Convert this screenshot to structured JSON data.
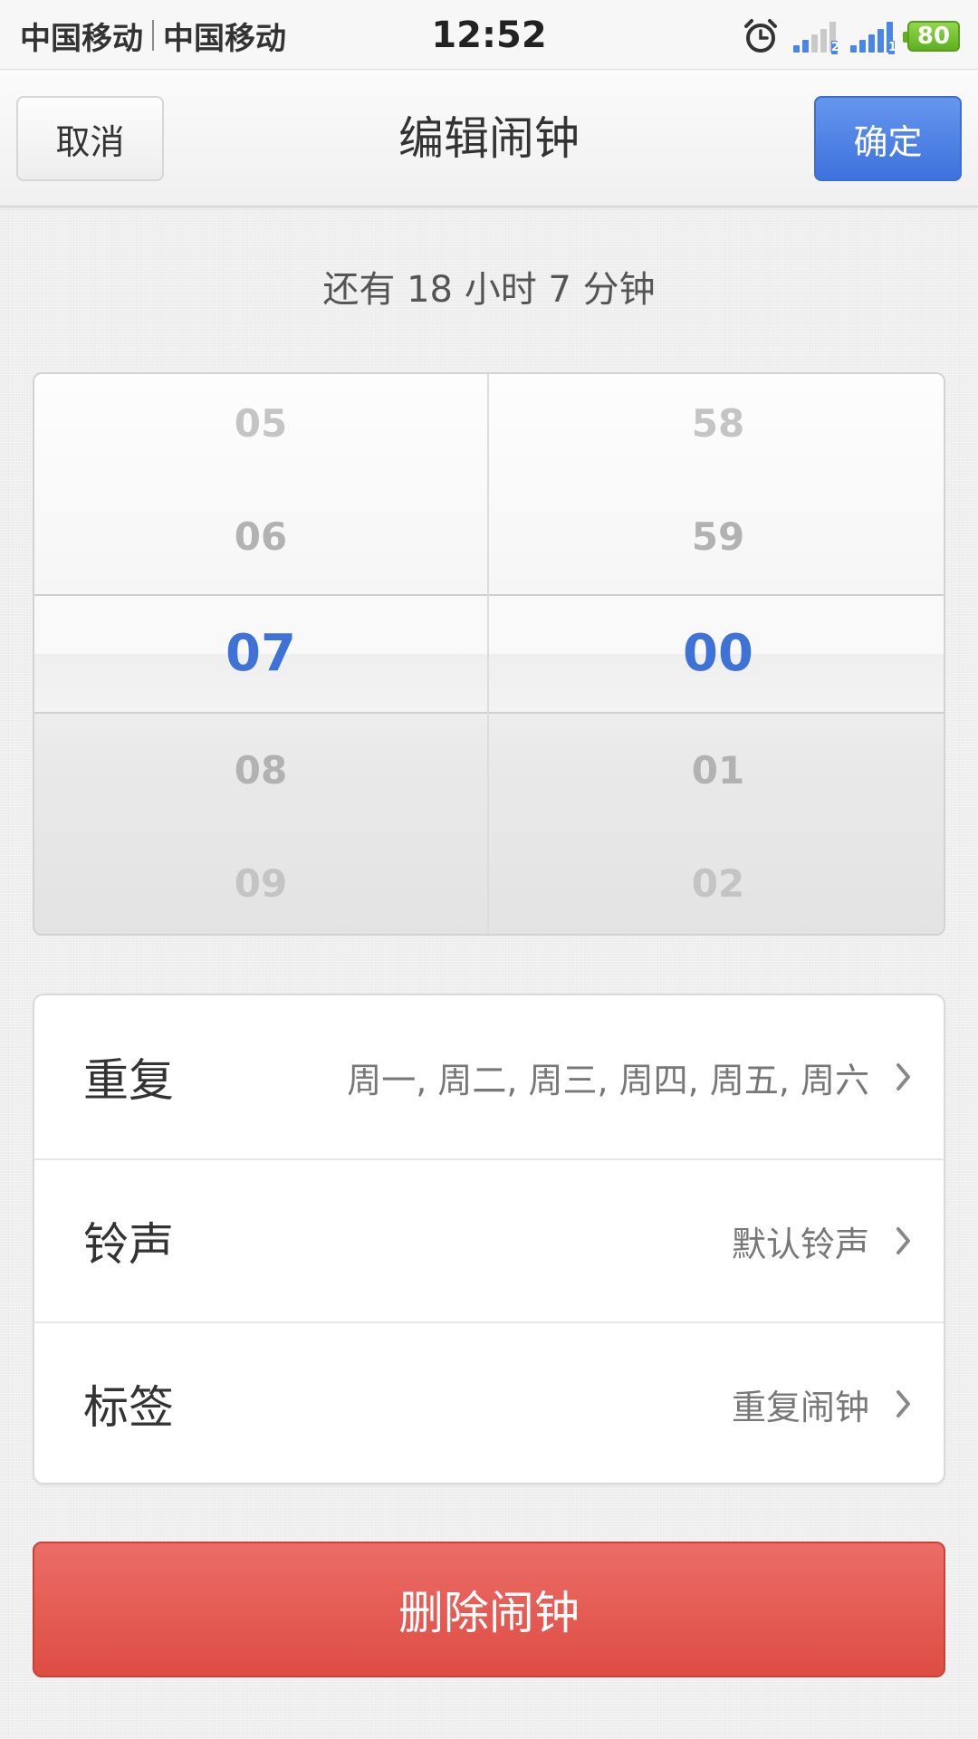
{
  "status_bar": {
    "carrier1": "中国移动",
    "carrier2": "中国移动",
    "time": "12:52",
    "sim1_label": "2",
    "sim2_label": "1",
    "battery": "80",
    "icons": [
      "alarm-icon",
      "signal-sim2-icon",
      "signal-sim1-icon",
      "battery-icon"
    ]
  },
  "header": {
    "cancel_label": "取消",
    "title": "编辑闹钟",
    "confirm_label": "确定"
  },
  "countdown_text": "还有 18 小时 7 分钟",
  "picker": {
    "hours": [
      "05",
      "06",
      "07",
      "08",
      "09"
    ],
    "minutes": [
      "58",
      "59",
      "00",
      "01",
      "02"
    ],
    "selected_hour": "07",
    "selected_minute": "00",
    "accent_color": "#3f72d6"
  },
  "settings": [
    {
      "label": "重复",
      "value": "周一, 周二, 周三, 周四, 周五, 周六",
      "icon": "chevron-right-icon"
    },
    {
      "label": "铃声",
      "value": "默认铃声",
      "icon": "chevron-right-icon"
    },
    {
      "label": "标签",
      "value": "重复闹钟",
      "icon": "chevron-right-icon"
    }
  ],
  "delete_label": "删除闹钟",
  "colors": {
    "primary_button": "#4a7fe3",
    "danger_button": "#e25a52"
  }
}
